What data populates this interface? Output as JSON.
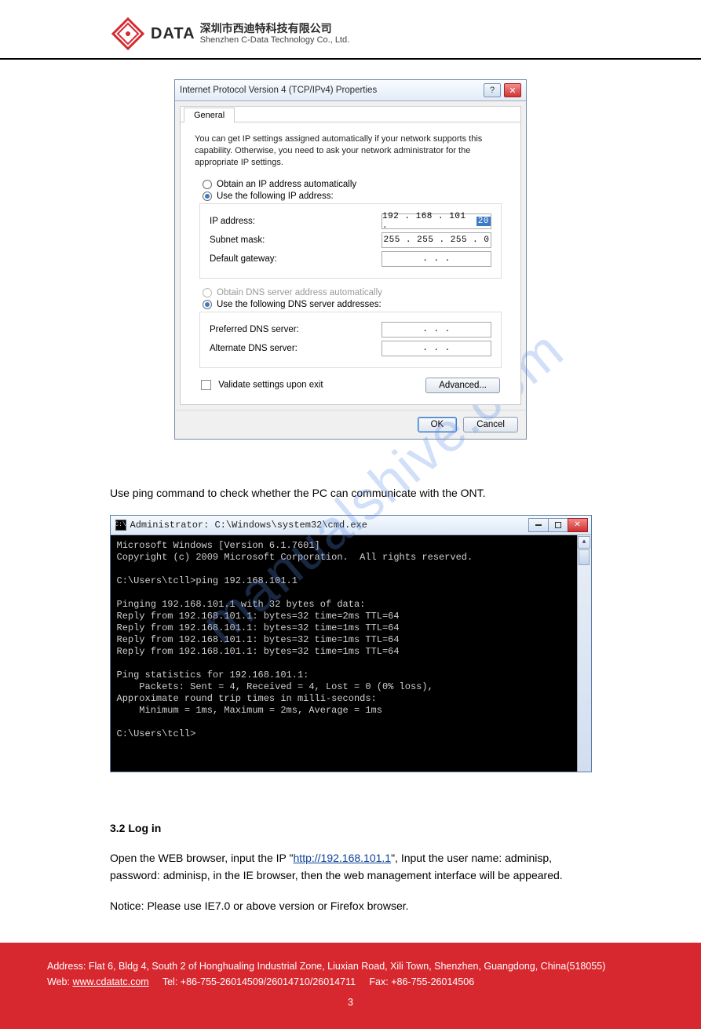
{
  "header": {
    "logo_word": "DATA",
    "company_cn": "深圳市西迪特科技有限公司",
    "company_en": "Shenzhen C-Data Technology Co., Ltd."
  },
  "ipv4_dialog": {
    "title": "Internet Protocol Version 4 (TCP/IPv4) Properties",
    "help_glyph": "?",
    "close_glyph": "✕",
    "tab": "General",
    "description": "You can get IP settings assigned automatically if your network supports this capability. Otherwise, you need to ask your network administrator for the appropriate IP settings.",
    "radio_auto_ip": "Obtain an IP address automatically",
    "radio_use_ip": "Use the following IP address:",
    "field_ip_label": "IP address:",
    "field_ip_value_prefix": "192 . 168 . 101 . ",
    "field_ip_value_selected": "20",
    "field_subnet_label": "Subnet mask:",
    "field_subnet_value": "255 . 255 . 255 .  0",
    "field_gateway_label": "Default gateway:",
    "field_gateway_value": ".        .        .",
    "radio_auto_dns": "Obtain DNS server address automatically",
    "radio_use_dns": "Use the following DNS server addresses:",
    "field_pref_dns_label": "Preferred DNS server:",
    "field_pref_dns_value": ".        .        .",
    "field_alt_dns_label": "Alternate DNS server:",
    "field_alt_dns_value": ".        .        .",
    "checkbox_validate": "Validate settings upon exit",
    "btn_advanced": "Advanced...",
    "btn_ok": "OK",
    "btn_cancel": "Cancel"
  },
  "mid_paragraph": "Use ping command to check whether the PC can communicate with the ONT.",
  "cmd": {
    "title": "Administrator: C:\\Windows\\system32\\cmd.exe",
    "lines": [
      "Microsoft Windows [Version 6.1.7601]",
      "Copyright (c) 2009 Microsoft Corporation.  All rights reserved.",
      "",
      "C:\\Users\\tcll>ping 192.168.101.1",
      "",
      "Pinging 192.168.101.1 with 32 bytes of data:",
      "Reply from 192.168.101.1: bytes=32 time=2ms TTL=64",
      "Reply from 192.168.101.1: bytes=32 time=1ms TTL=64",
      "Reply from 192.168.101.1: bytes=32 time=1ms TTL=64",
      "Reply from 192.168.101.1: bytes=32 time=1ms TTL=64",
      "",
      "Ping statistics for 192.168.101.1:",
      "    Packets: Sent = 4, Received = 4, Lost = 0 (0% loss),",
      "Approximate round trip times in milli-seconds:",
      "    Minimum = 1ms, Maximum = 2ms, Average = 1ms",
      "",
      "C:\\Users\\tcll>"
    ]
  },
  "body": {
    "heading": "3.2 Log in",
    "para1_prefix": "Open the WEB browser, input the IP \"",
    "para1_link": "http://192.168.101.1",
    "para1_suffix": "\",  Input the user name: adminisp, password: adminisp, in the IE browser, then the web management interface will be appeared.",
    "note": "Notice: Please use IE7.0 or above version or Firefox browser."
  },
  "watermark": "manualshive.com",
  "footer": {
    "addr_label": "Address:",
    "addr": "Flat 6, Bldg 4, South 2 of Honghualing Industrial Zone, Liuxian Road, Xili Town, Shenzhen, Guangdong, China(518055)",
    "web_label": "Web:",
    "web": "www.cdatatc.com",
    "tel_label": "Tel:",
    "tel": "+86-755-26014509/26014710/26014711",
    "fax_label": "Fax:",
    "fax": "+86-755-26014506",
    "page": "3"
  }
}
